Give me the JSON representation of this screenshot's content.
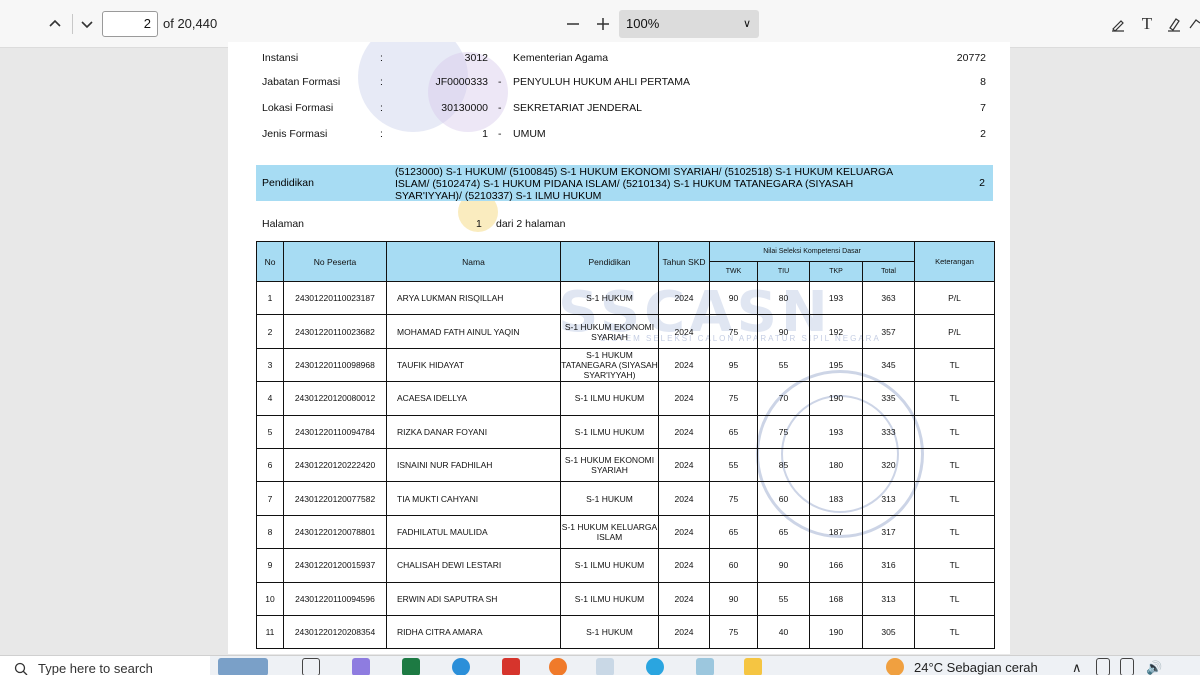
{
  "toolbar": {
    "page_current": "2",
    "page_total": "of 20,440",
    "zoom": "100%"
  },
  "header": {
    "rows": [
      {
        "label": "Instansi",
        "sep": ":",
        "code": "3012",
        "dash": "",
        "value": "Kementerian Agama",
        "count": "20772"
      },
      {
        "label": "Jabatan Formasi",
        "sep": ":",
        "code": "JF0000333",
        "dash": "-",
        "value": "PENYULUH HUKUM AHLI PERTAMA",
        "count": "8"
      },
      {
        "label": "Lokasi Formasi",
        "sep": ":",
        "code": "30130000",
        "dash": "-",
        "value": "SEKRETARIAT JENDERAL",
        "count": "7"
      },
      {
        "label": "Jenis Formasi",
        "sep": ":",
        "code": "1",
        "dash": "-",
        "value": "UMUM",
        "count": "2"
      }
    ],
    "pendidikan_label": "Pendidikan",
    "pendidikan_text": "(5123000) S-1 HUKUM/ (5100845) S-1 HUKUM EKONOMI SYARIAH/ (5102518) S-1 HUKUM KELUARGA ISLAM/ (5102474) S-1 HUKUM PIDANA ISLAM/ (5210134) S-1 HUKUM TATANEGARA (SIYASAH SYAR'IYYAH)/ (5210337) S-1 ILMU HUKUM",
    "pendidikan_count": "2",
    "halaman_label": "Halaman",
    "halaman_num": "1",
    "halaman_of": "dari 2 halaman"
  },
  "watermark": {
    "text": "SSCASN",
    "sub": "SISTEM SELEKSI CALON APARATUR SIPIL NEGARA"
  },
  "table": {
    "headers": {
      "no": "No",
      "peserta": "No Peserta",
      "nama": "Nama",
      "pendidikan": "Pendidikan",
      "tahun": "Tahun SKD",
      "nilai": "Nilai Seleksi Kompetensi Dasar",
      "twk": "TWK",
      "tiu": "TIU",
      "tkp": "TKP",
      "total": "Total",
      "ket": "Keterangan"
    },
    "rows": [
      {
        "no": "1",
        "peserta": "24301220110023187",
        "nama": "ARYA LUKMAN RISQILLAH",
        "pend": "S-1 HUKUM",
        "tahun": "2024",
        "twk": "90",
        "tiu": "80",
        "tkp": "193",
        "total": "363",
        "ket": "P/L"
      },
      {
        "no": "2",
        "peserta": "24301220110023682",
        "nama": "MOHAMAD FATH AINUL YAQIN",
        "pend": "S-1 HUKUM EKONOMI SYARIAH",
        "tahun": "2024",
        "twk": "75",
        "tiu": "90",
        "tkp": "192",
        "total": "357",
        "ket": "P/L"
      },
      {
        "no": "3",
        "peserta": "24301220110098968",
        "nama": "TAUFIK HIDAYAT",
        "pend": "S-1 HUKUM TATANEGARA (SIYASAH SYAR'IYYAH)",
        "tahun": "2024",
        "twk": "95",
        "tiu": "55",
        "tkp": "195",
        "total": "345",
        "ket": "TL"
      },
      {
        "no": "4",
        "peserta": "24301220120080012",
        "nama": "ACAESA IDELLYA",
        "pend": "S-1 ILMU HUKUM",
        "tahun": "2024",
        "twk": "75",
        "tiu": "70",
        "tkp": "190",
        "total": "335",
        "ket": "TL"
      },
      {
        "no": "5",
        "peserta": "24301220110094784",
        "nama": "RIZKA DANAR FOYANI",
        "pend": "S-1 ILMU HUKUM",
        "tahun": "2024",
        "twk": "65",
        "tiu": "75",
        "tkp": "193",
        "total": "333",
        "ket": "TL"
      },
      {
        "no": "6",
        "peserta": "24301220120222420",
        "nama": "ISNAINI NUR FADHILAH",
        "pend": "S-1 HUKUM EKONOMI SYARIAH",
        "tahun": "2024",
        "twk": "55",
        "tiu": "85",
        "tkp": "180",
        "total": "320",
        "ket": "TL"
      },
      {
        "no": "7",
        "peserta": "24301220120077582",
        "nama": "TIA MUKTI CAHYANI",
        "pend": "S-1 HUKUM",
        "tahun": "2024",
        "twk": "75",
        "tiu": "60",
        "tkp": "183",
        "total": "313",
        "ket": "TL"
      },
      {
        "no": "8",
        "peserta": "24301220120078801",
        "nama": "FADHILATUL MAULIDA",
        "pend": "S-1 HUKUM KELUARGA ISLAM",
        "tahun": "2024",
        "twk": "65",
        "tiu": "65",
        "tkp": "187",
        "total": "317",
        "ket": "TL"
      },
      {
        "no": "9",
        "peserta": "24301220120015937",
        "nama": "CHALISAH DEWI LESTARI",
        "pend": "S-1 ILMU HUKUM",
        "tahun": "2024",
        "twk": "60",
        "tiu": "90",
        "tkp": "166",
        "total": "316",
        "ket": "TL"
      },
      {
        "no": "10",
        "peserta": "24301220110094596",
        "nama": "ERWIN ADI SAPUTRA SH",
        "pend": "S-1 ILMU HUKUM",
        "tahun": "2024",
        "twk": "90",
        "tiu": "55",
        "tkp": "168",
        "total": "313",
        "ket": "TL"
      },
      {
        "no": "11",
        "peserta": "24301220120208354",
        "nama": "RIDHA CITRA AMARA",
        "pend": "S-1 HUKUM",
        "tahun": "2024",
        "twk": "75",
        "tiu": "40",
        "tkp": "190",
        "total": "305",
        "ket": "TL"
      }
    ]
  },
  "taskbar": {
    "search_placeholder": "Type here to search",
    "weather": "24°C  Sebagian cerah"
  },
  "colors": {
    "header_band": "#a7dcf3",
    "toolbar_bg": "#f7f7f7",
    "taskbar_bg": "#eef1f5"
  }
}
